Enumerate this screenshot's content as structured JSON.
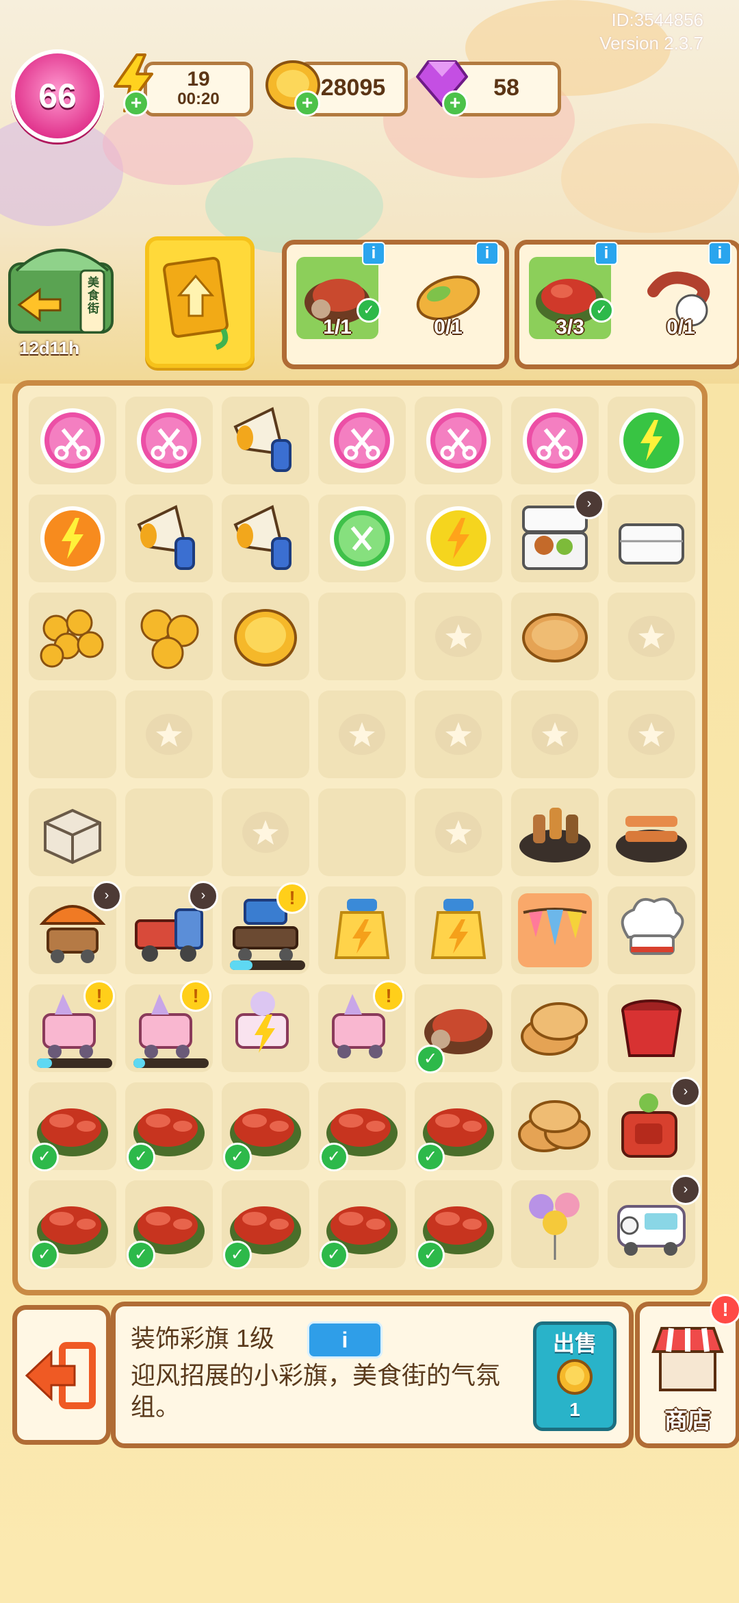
{
  "version": {
    "id": "ID:3544856",
    "version": "Version 2.3.7"
  },
  "hud": {
    "level": "66",
    "energy": {
      "value": "19",
      "timer": "00:20",
      "icon": "lightning-icon"
    },
    "coins": {
      "value": "28095",
      "icon": "coin-icon"
    },
    "gems": {
      "value": "58",
      "icon": "gem-icon"
    }
  },
  "street": {
    "sign": "美食街",
    "timer": "12d11h"
  },
  "orders": [
    {
      "slots": [
        {
          "item": "grilled-meat",
          "count": "1/1",
          "done": true
        },
        {
          "item": "burrito",
          "count": "0/1",
          "done": false
        }
      ]
    },
    {
      "slots": [
        {
          "item": "crawfish",
          "count": "3/3",
          "done": true
        },
        {
          "item": "sausage",
          "count": "0/1",
          "done": false
        }
      ]
    }
  ],
  "selected": {
    "name": "装饰彩旗 1级",
    "info_label": "i",
    "description": "迎风招展的小彩旗，美食街的气氛组。",
    "sell_label": "出售",
    "sell_value": "1"
  },
  "shop": {
    "label": "商店",
    "badge": "!"
  },
  "colors": {
    "accent": "#b06c35",
    "gold": "#f5b82a",
    "pink": "#e2378f",
    "green": "#2db94a",
    "teal": "#29b3c9"
  },
  "board": [
    [
      "scissors-pink",
      "scissors-pink",
      "megaphone",
      "scissors-pink",
      "scissors-pink",
      "scissors-pink",
      "energy-green"
    ],
    [
      "energy-orange",
      "megaphone",
      "megaphone",
      "scissors-green",
      "energy-yellow",
      "bento-open",
      "bento-closed"
    ],
    [
      "coins-pile",
      "coins-stack",
      "coin",
      "empty",
      "star",
      "flatbread",
      "star"
    ],
    [
      "empty",
      "star",
      "empty",
      "star",
      "star",
      "star",
      "star"
    ],
    [
      "box",
      "empty",
      "star",
      "empty",
      "star",
      "skewers",
      "skewers2"
    ],
    [
      "cart-orange",
      "truck",
      "grill-cart",
      "energy-bottle",
      "energy-bottle",
      "bunting",
      "chef-hat"
    ],
    [
      "icecream-cart",
      "icecream-cart",
      "icecream-cart-energy",
      "icecream-cart",
      "grilled-meat",
      "flatbread2",
      "bucket"
    ],
    [
      "crawfish",
      "crawfish",
      "crawfish",
      "crawfish",
      "crawfish",
      "flatbread3",
      "toaster"
    ],
    [
      "crawfish",
      "crawfish",
      "crawfish",
      "crawfish",
      "crawfish",
      "balloons",
      "food-van"
    ]
  ]
}
